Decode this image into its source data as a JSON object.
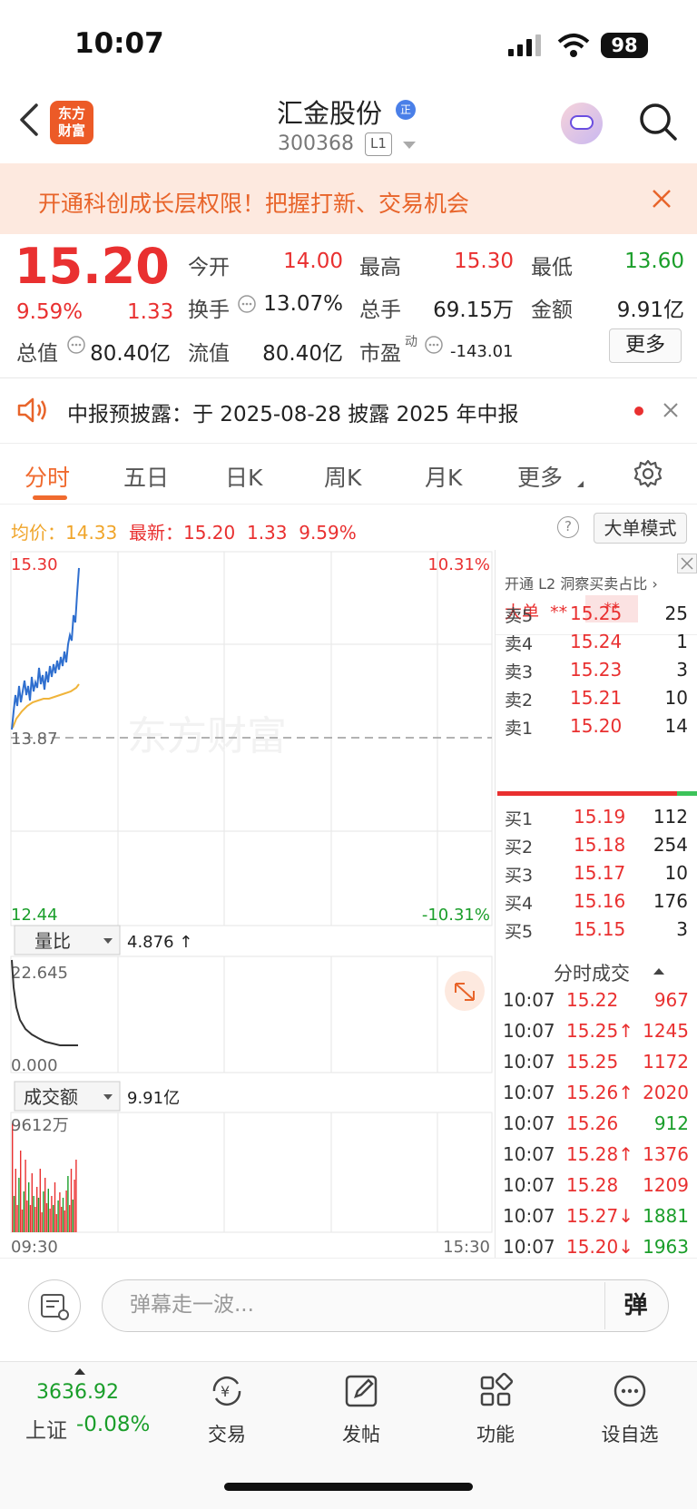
{
  "status_bar": {
    "time": "10:07",
    "battery": "98"
  },
  "header": {
    "logo_line1": "东方",
    "logo_line2": "财富",
    "stock_name": "汇金股份",
    "badge": "正",
    "stock_code": "300368",
    "level": "L1"
  },
  "banner": {
    "text": "开通科创成长层权限！把握打新、交易机会"
  },
  "quote": {
    "price": "15.20",
    "change_pct": "9.59%",
    "change": "1.33",
    "open_label": "今开",
    "open": "14.00",
    "high_label": "最高",
    "high": "15.30",
    "low_label": "最低",
    "low": "13.60",
    "turnover_label": "换手",
    "turnover": "13.07%",
    "volume_label": "总手",
    "volume": "69.15万",
    "amount_label": "金额",
    "amount": "9.91亿",
    "mktcap_label": "总值",
    "mktcap": "80.40亿",
    "float_label": "流值",
    "float": "80.40亿",
    "pe_label": "市盈",
    "pe_sup": "动",
    "pe": "-143.01",
    "more": "更多"
  },
  "notice": {
    "text": "中报预披露：于 2025-08-28 披露 2025 年中报"
  },
  "tabs": [
    {
      "label": "分时"
    },
    {
      "label": "五日"
    },
    {
      "label": "日K"
    },
    {
      "label": "周K"
    },
    {
      "label": "月K"
    },
    {
      "label": "更多"
    }
  ],
  "info": {
    "avg_label": "均价：",
    "avg": "14.33",
    "latest_label": "最新：",
    "latest": "15.20",
    "chg": "1.33",
    "pct": "9.59%",
    "big_mode": "大单模式",
    "help": "?"
  },
  "chart": {
    "price_max": "15.30",
    "price_min": "12.44",
    "prev_close": "13.87",
    "pct_max": "10.31%",
    "pct_min": "-10.31%",
    "vr_label": "量比",
    "vr_value": "4.876 ↑",
    "vr_max": "22.645",
    "vr_min": "0.000",
    "amt_label": "成交额",
    "amt_value": "9.91亿",
    "amt_max": "9612万",
    "time_start": "09:30",
    "time_end": "15:30",
    "watermark": "东方财富"
  },
  "orderbook": {
    "promo": "开通 L2 洞察买卖占比 ›",
    "big_label": "大单",
    "big_val": "**",
    "big_val2": "**",
    "asks": [
      {
        "label": "卖5",
        "price": "15.25",
        "vol": "25"
      },
      {
        "label": "卖4",
        "price": "15.24",
        "vol": "1"
      },
      {
        "label": "卖3",
        "price": "15.23",
        "vol": "3"
      },
      {
        "label": "卖2",
        "price": "15.21",
        "vol": "10"
      },
      {
        "label": "卖1",
        "price": "15.20",
        "vol": "14"
      }
    ],
    "bids": [
      {
        "label": "买1",
        "price": "15.19",
        "vol": "112"
      },
      {
        "label": "买2",
        "price": "15.18",
        "vol": "254"
      },
      {
        "label": "买3",
        "price": "15.17",
        "vol": "10"
      },
      {
        "label": "买4",
        "price": "15.16",
        "vol": "176"
      },
      {
        "label": "买5",
        "price": "15.15",
        "vol": "3"
      }
    ],
    "ticks_title": "分时成交",
    "ticks": [
      {
        "time": "10:07",
        "price": "15.22",
        "vol": "967",
        "dir": "buy"
      },
      {
        "time": "10:07",
        "price": "15.25↑",
        "vol": "1245",
        "dir": "buy"
      },
      {
        "time": "10:07",
        "price": "15.25",
        "vol": "1172",
        "dir": "buy"
      },
      {
        "time": "10:07",
        "price": "15.26↑",
        "vol": "2020",
        "dir": "buy"
      },
      {
        "time": "10:07",
        "price": "15.26",
        "vol": "912",
        "dir": "sell"
      },
      {
        "time": "10:07",
        "price": "15.28↑",
        "vol": "1376",
        "dir": "buy"
      },
      {
        "time": "10:07",
        "price": "15.28",
        "vol": "1209",
        "dir": "buy"
      },
      {
        "time": "10:07",
        "price": "15.27↓",
        "vol": "1881",
        "dir": "sell"
      },
      {
        "time": "10:07",
        "price": "15.20↓",
        "vol": "1963",
        "dir": "sell"
      }
    ]
  },
  "danmu": {
    "placeholder": "弹幕走一波...",
    "button": "弹"
  },
  "bottom_nav": {
    "index_value": "3636.92",
    "index_name": "上证",
    "index_pct": "-0.08%",
    "items": [
      {
        "label": "交易"
      },
      {
        "label": "发帖"
      },
      {
        "label": "功能"
      },
      {
        "label": "设自选"
      }
    ]
  },
  "colors": {
    "up": "#e93030",
    "down": "#1a9e2a",
    "accent": "#f06a2e",
    "price_line": "#2f6fcf",
    "avg_line": "#f0b43a"
  }
}
